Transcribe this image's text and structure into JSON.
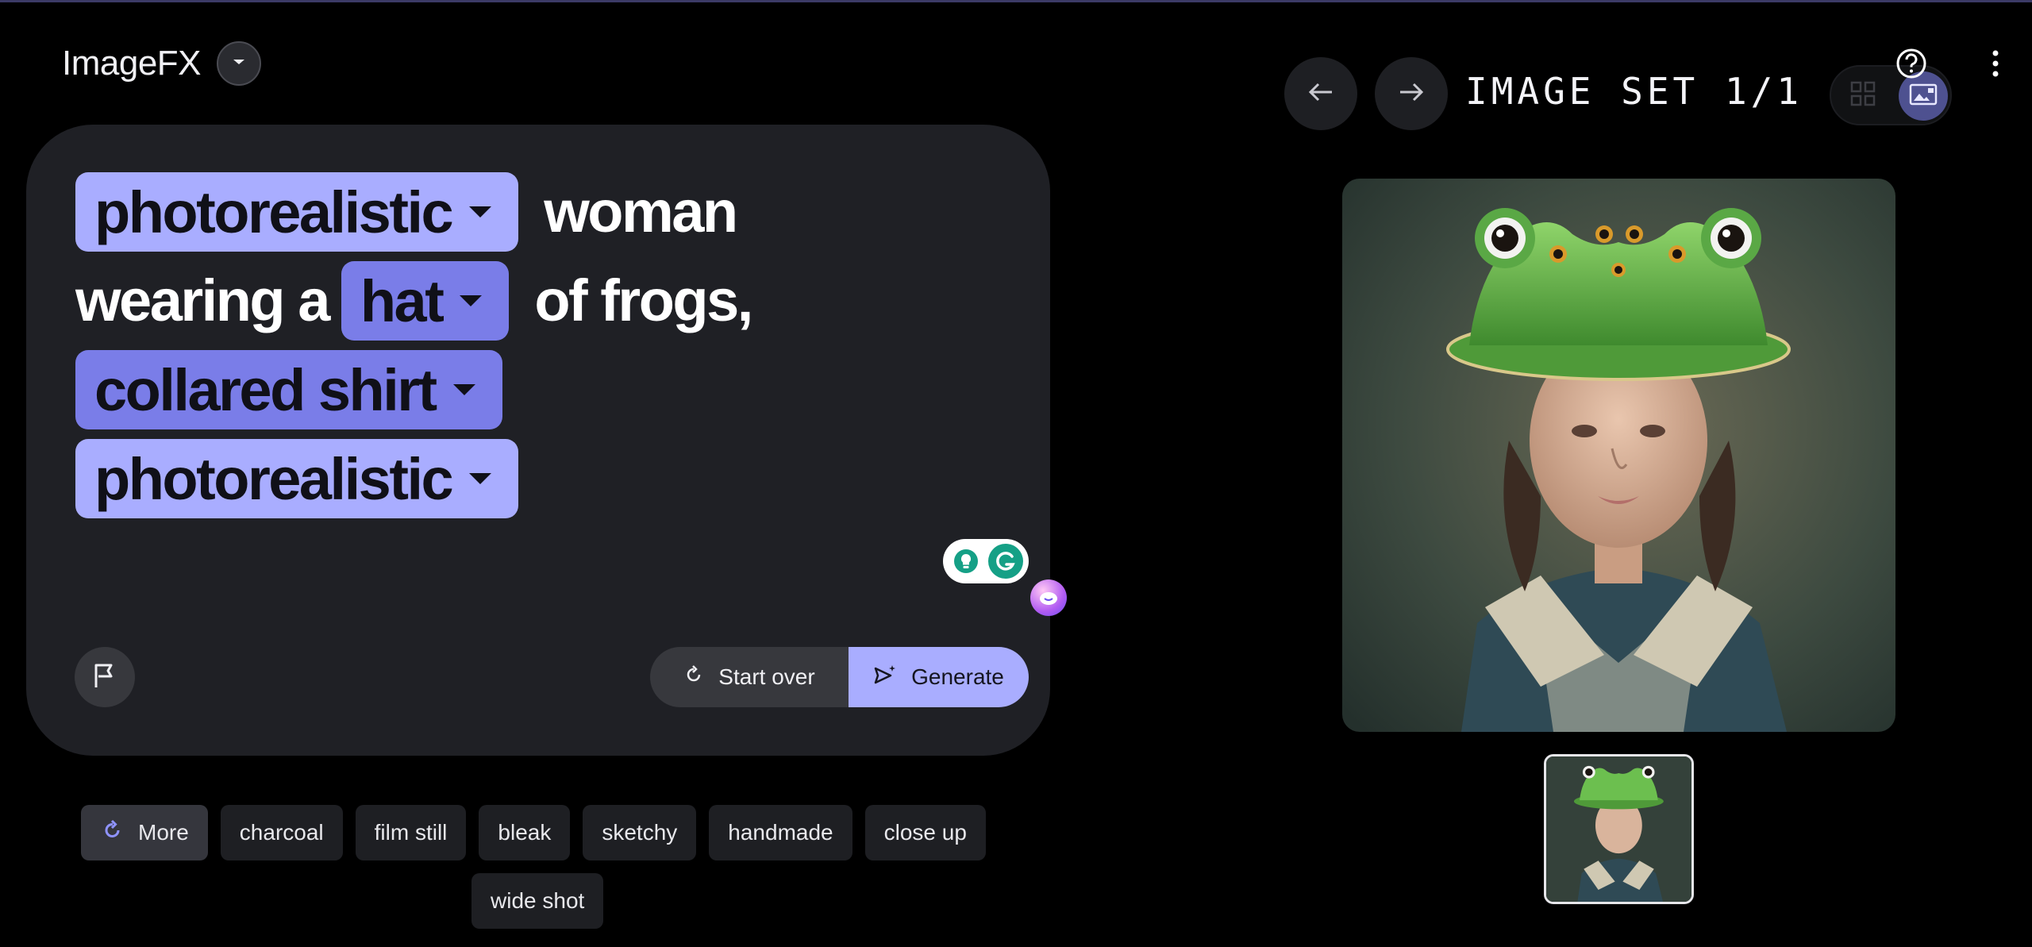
{
  "app": {
    "title": "ImageFX"
  },
  "prompt": {
    "line1": {
      "chip1": "photorealistic",
      "word": "woman"
    },
    "line2": {
      "word1": "wearing a",
      "chip": "hat",
      "word2": "of frogs,"
    },
    "line3": {
      "chip": "collared shirt"
    },
    "line4": {
      "chip": "photorealistic"
    }
  },
  "actions": {
    "start_over": "Start over",
    "generate": "Generate"
  },
  "suggestions": {
    "more": "More",
    "items": [
      "charcoal",
      "film still",
      "bleak",
      "sketchy",
      "handmade",
      "close up",
      "wide shot"
    ]
  },
  "viewer": {
    "set_label": "IMAGE SET 1/1"
  },
  "colors": {
    "chip_light": "#a9adff",
    "chip_dark": "#7a7de8",
    "card_bg": "#1f2025",
    "accent": "#a9adff"
  },
  "icons": {
    "brand_dropdown": "chevron-down-icon",
    "flag": "flag-icon",
    "refresh": "refresh-icon",
    "send_sparkle": "send-sparkle-icon",
    "prev": "arrow-left-icon",
    "next": "arrow-right-icon",
    "grid_view": "grid-view-icon",
    "single_view": "single-view-icon",
    "help": "help-icon",
    "menu": "more-vert-icon"
  }
}
